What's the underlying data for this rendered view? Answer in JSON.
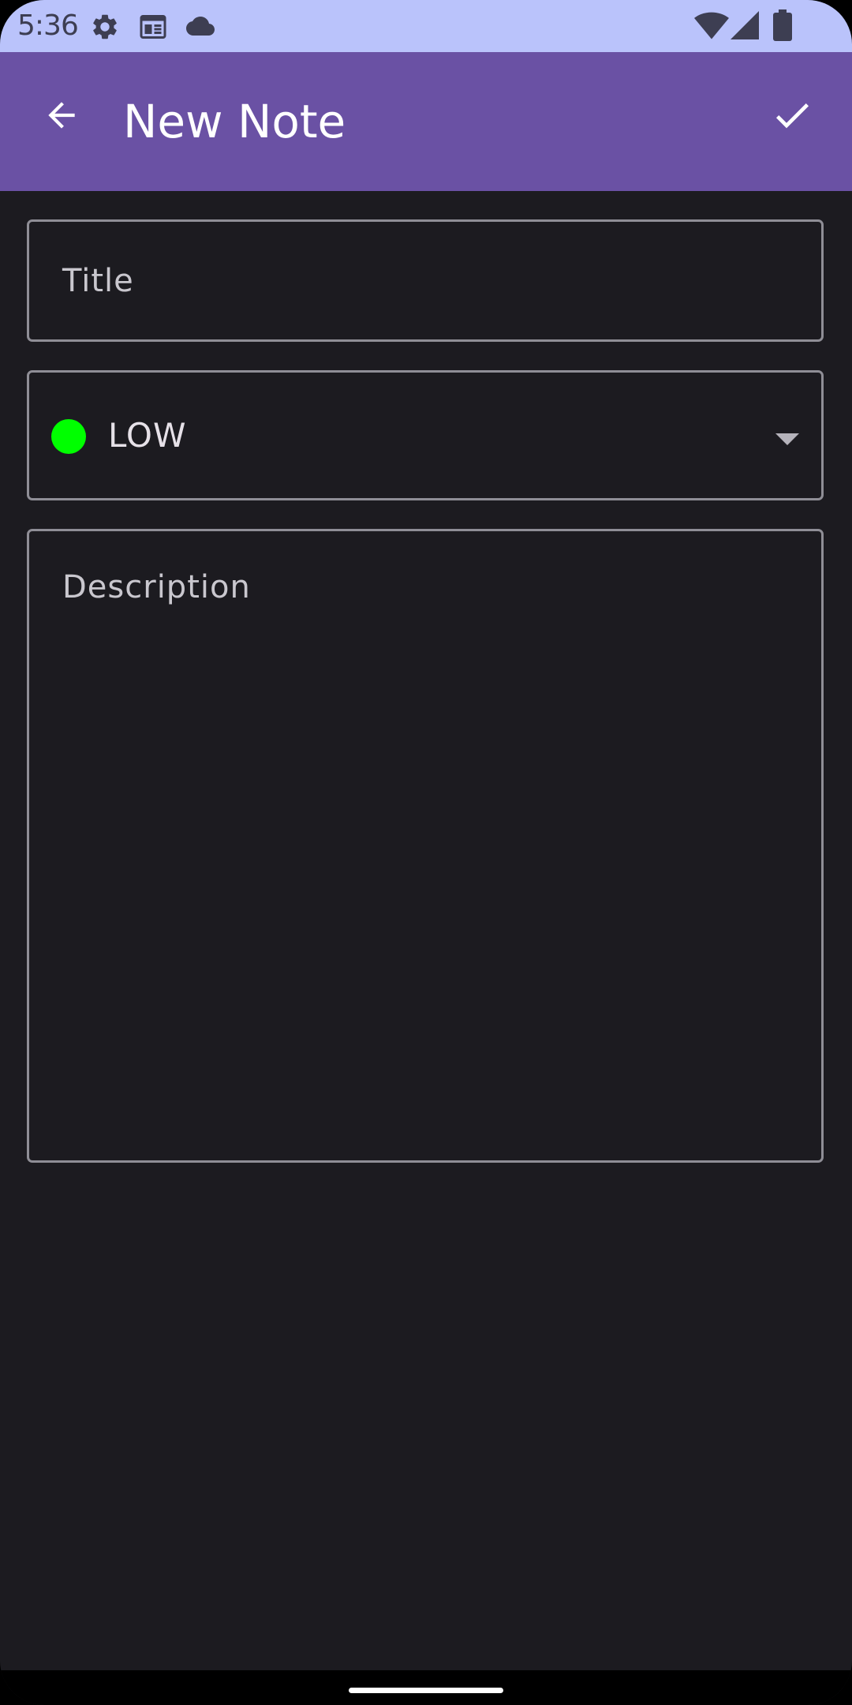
{
  "status_bar": {
    "time": "5:36",
    "left_icons": [
      "gear-icon",
      "calendar-icon",
      "cloud-icon"
    ],
    "right_icons": [
      "wifi-icon",
      "cellular-signal-icon",
      "battery-icon"
    ],
    "background": "#bac3fb"
  },
  "app_bar": {
    "title": "New Note",
    "back_icon": "arrow-back-icon",
    "save_icon": "check-icon",
    "background": "#6a51a4"
  },
  "form": {
    "title_field": {
      "value": "",
      "placeholder": "Title"
    },
    "priority": {
      "selected": "LOW",
      "indicator_color": "#00ff00",
      "dropdown_icon": "arrow-drop-down-icon"
    },
    "description_field": {
      "value": "",
      "placeholder": "Description"
    }
  },
  "theme": {
    "background": "#1c1b20",
    "outline": "#8f8e96"
  }
}
